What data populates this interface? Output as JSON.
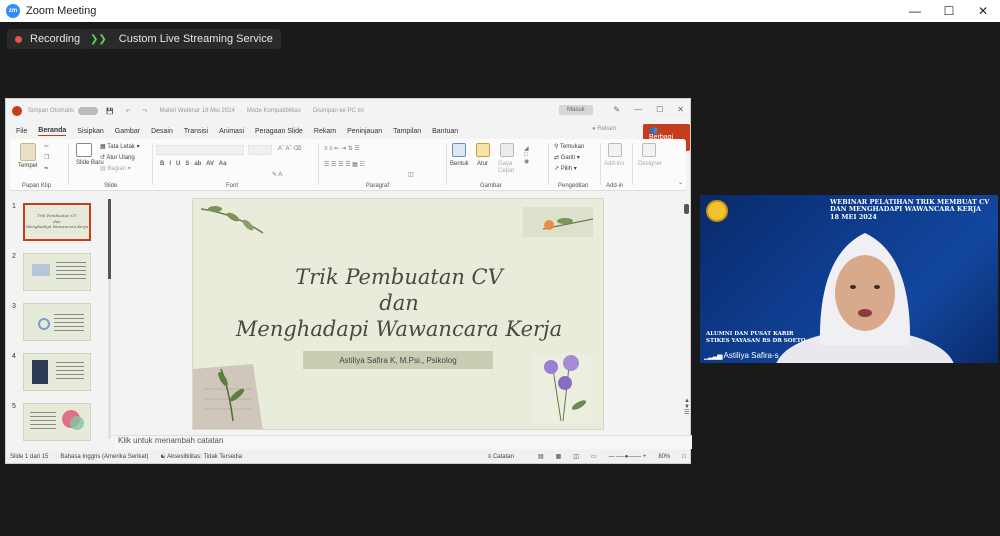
{
  "titlebar": {
    "app_title": "Zoom Meeting",
    "logo_text": "zm"
  },
  "meeting_bar": {
    "recording_label": "Recording",
    "streaming_label": "Custom Live Streaming Service"
  },
  "ppt": {
    "top": {
      "autosave": "Simpan Otomatis",
      "filename": "Materi Webinar 18 Mei 2024",
      "mode": "Mode Kompatibilitas",
      "saved": "Disimpan ke PC Ini",
      "signin": "Masuk"
    },
    "tabs": [
      "File",
      "Beranda",
      "Sisipkan",
      "Gambar",
      "Desain",
      "Transisi",
      "Animasi",
      "Peragaan Slide",
      "Rekam",
      "Peninjauan",
      "Tampilan",
      "Bantuan"
    ],
    "active_tab": "Beranda",
    "rekam": "Rekam",
    "berbagi": "Berbagi",
    "ribbon": {
      "tempel": "Tempel",
      "papan_klip": "Papan Klip",
      "slide_baru": "Slide Baru",
      "tata_letak": "Tata Letak",
      "atur_ulang": "Atur Ulang",
      "bagian": "Bagian",
      "slide": "Slide",
      "font": "Font",
      "paragraf": "Paragraf",
      "bentuk": "Bentuk",
      "atur": "Atur",
      "gaya_cepat": "Gaya Cepat",
      "gambar": "Gambar",
      "temukan": "Temukan",
      "ganti": "Ganti",
      "pilih": "Pilih",
      "pengeditan": "Pengeditan",
      "add_ins": "Add-ins",
      "add_in": "Add-in",
      "designer": "Designer"
    },
    "thumb_numbers": [
      "1",
      "2",
      "3",
      "4",
      "5"
    ],
    "slide": {
      "title_line1": "Trik Pembuatan CV",
      "title_line2": "dan",
      "title_line3": "Menghadapi Wawancara Kerja",
      "presenter": "Astiliya Safira K, M.Psi., Psikolog"
    },
    "notes_placeholder": "Klik untuk menambah catatan",
    "status": {
      "slide_count": "Slide 1 dari 15",
      "language": "Bahasa Inggris (Amerika Serikat)",
      "accessibility": "Aksesibilitas: Tidak Tersedia",
      "notes": "Catatan",
      "zoom": "80%"
    }
  },
  "video": {
    "header": "WEBINAR PELATIHAN TRIK MEMBUAT CV DAN MENGHADAPI WAWANCARA KERJA 18 MEI 2024",
    "bottom_line1": "ALUMNI DAN PUSAT KARIR",
    "bottom_line2": "STIKES YAYASAN RS DR SOETO",
    "participant_name": "Astiliya Safira-s"
  },
  "colors": {
    "zoom_blue": "#2d8cff",
    "ppt_accent": "#c43e1c",
    "rec_red": "#e5534b",
    "stream_green": "#5fd35f"
  }
}
